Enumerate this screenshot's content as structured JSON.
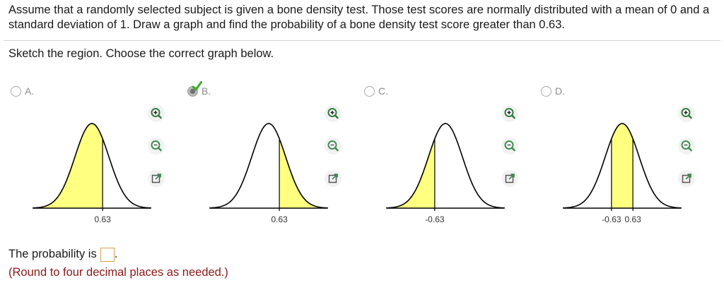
{
  "question": {
    "text": "Assume that a randomly selected subject is given a bone density test. Those test scores are normally distributed with a mean of 0 and a standard deviation of 1. Draw a graph and find the probability of a bone density test score greater than 0.63."
  },
  "instruction": "Sketch the region. Choose the correct graph below.",
  "options": [
    {
      "letter": "A.",
      "selected": false,
      "shading": "left of 0.63",
      "tick_labels": [
        "0.63"
      ]
    },
    {
      "letter": "B.",
      "selected": true,
      "shading": "right of 0.63",
      "tick_labels": [
        "0.63"
      ]
    },
    {
      "letter": "C.",
      "selected": false,
      "shading": "left of -0.63",
      "tick_labels": [
        "-0.63"
      ]
    },
    {
      "letter": "D.",
      "selected": false,
      "shading": "between -0.63 and 0.63",
      "tick_labels": [
        "-0.63",
        "0.63"
      ]
    }
  ],
  "icons": {
    "zoom_in": "zoom-in-icon",
    "zoom_out": "zoom-out-icon",
    "popout": "popout-icon",
    "correct": "checkmark-icon"
  },
  "colors": {
    "shade": "#ffff80",
    "check": "#3fae2a",
    "tool_fill": "#3d8e4d",
    "note": "#8b1a1a",
    "answer_border": "#d8a04a"
  },
  "answer": {
    "prefix": "The probability is",
    "suffix": ".",
    "value": "",
    "note": "(Round to four decimal places as needed.)"
  }
}
